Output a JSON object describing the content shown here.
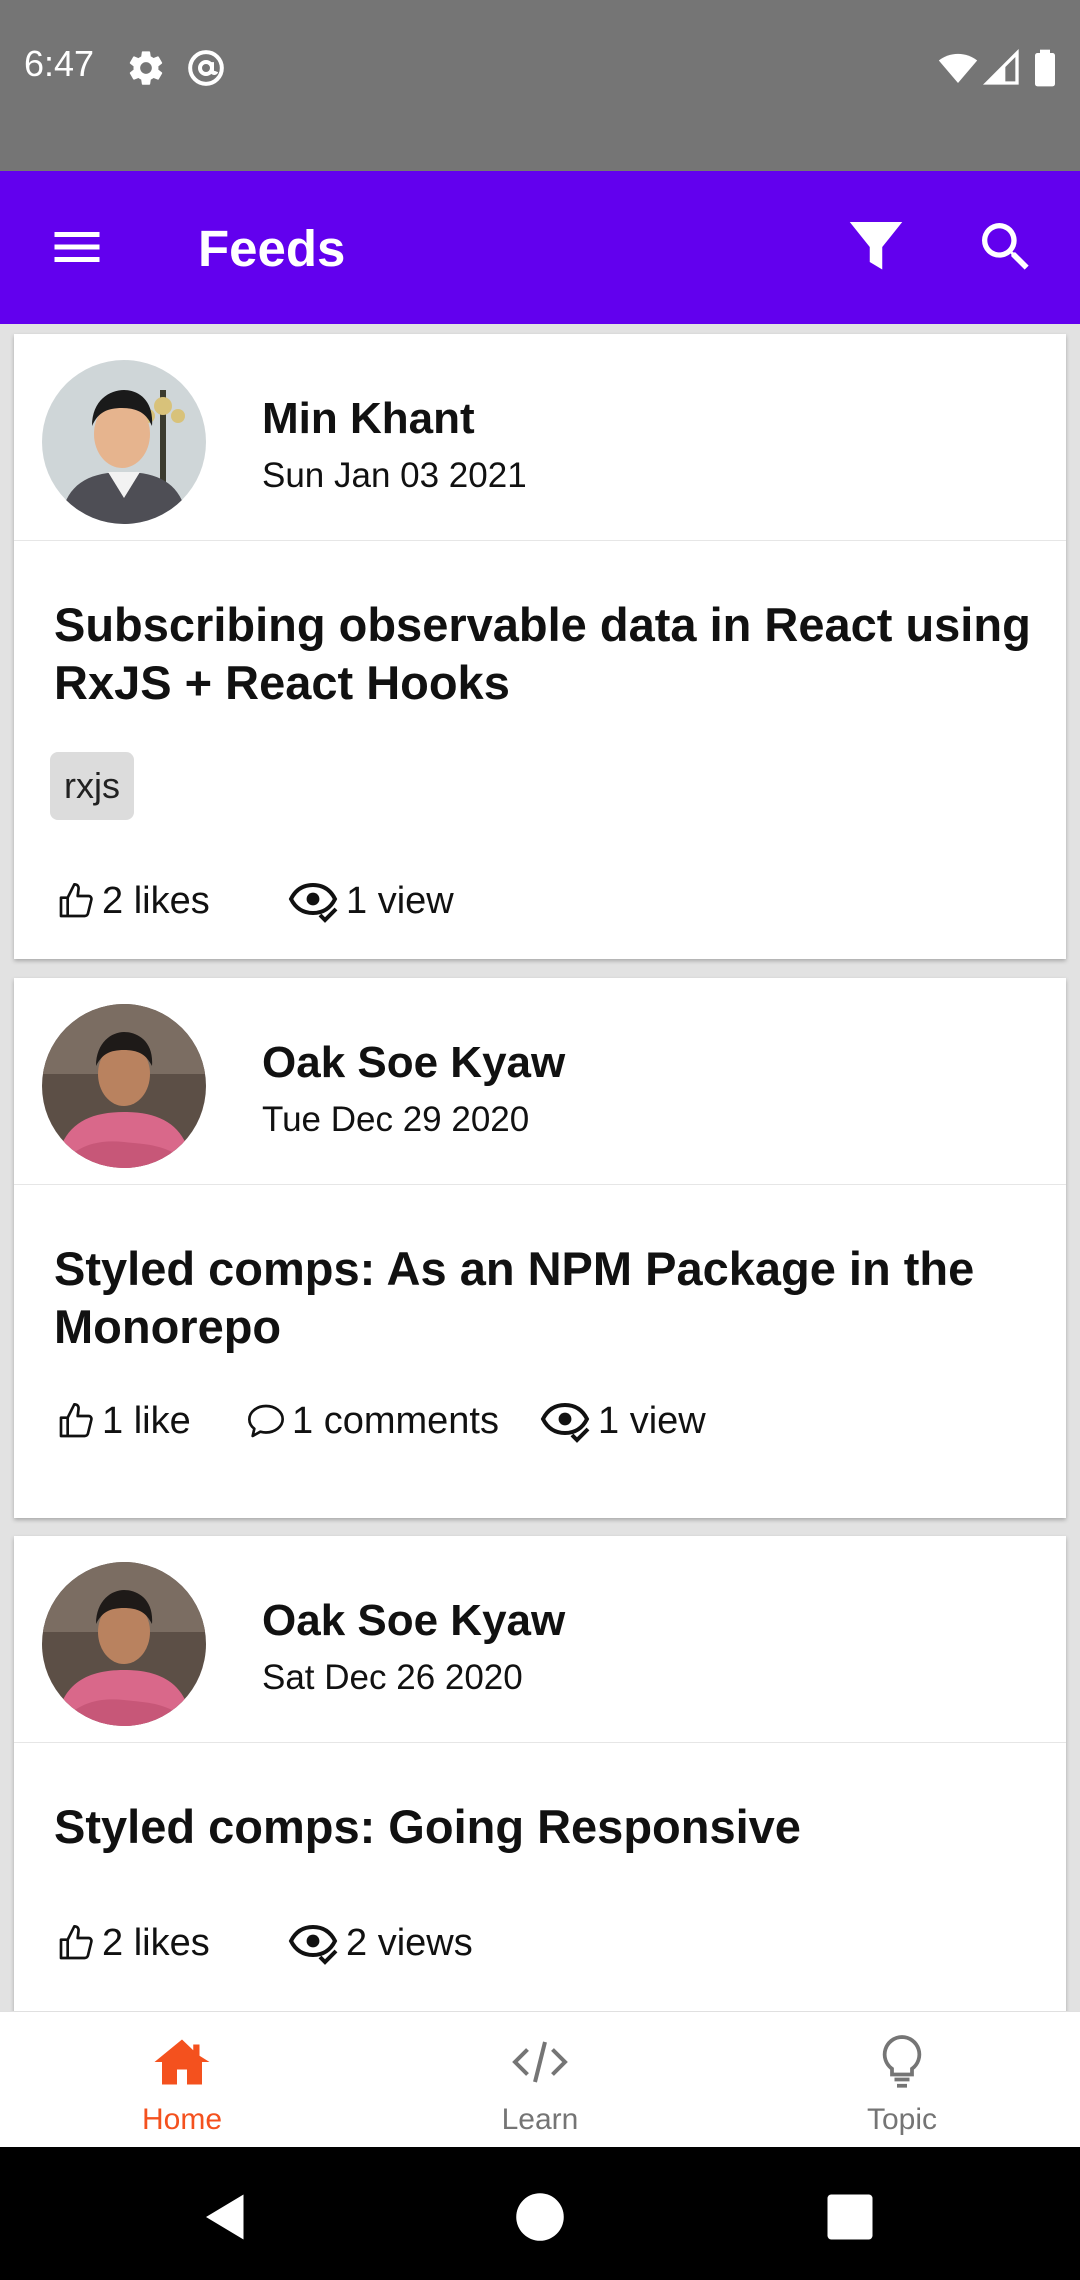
{
  "status_bar": {
    "time": "6:47",
    "icons": [
      "gear-icon",
      "at-sign-icon",
      "wifi-icon",
      "signal-icon",
      "battery-icon"
    ]
  },
  "app_bar": {
    "title": "Feeds",
    "background": "#6200ee",
    "icons": [
      "menu-icon",
      "filter-icon",
      "search-icon"
    ]
  },
  "feed": {
    "posts": [
      {
        "author": "Min Khant",
        "date": "Sun Jan 03 2021",
        "title": "Subscribing observable data in React using RxJS + React Hooks",
        "tags": [
          "rxjs"
        ],
        "likes": "2 likes",
        "comments": "",
        "views": "1 view"
      },
      {
        "author": "Oak Soe Kyaw",
        "date": "Tue Dec 29 2020",
        "title": "Styled comps: As an NPM Package in the Monorepo",
        "tags": [],
        "likes": "1 like",
        "comments": "1 comments",
        "views": "1 view"
      },
      {
        "author": "Oak Soe Kyaw",
        "date": "Sat Dec 26 2020",
        "title": "Styled comps: Going Responsive",
        "tags": [],
        "likes": "2 likes",
        "comments": "",
        "views": "2 views"
      }
    ]
  },
  "bottom_nav": {
    "items": [
      {
        "label": "Home",
        "icon": "home-icon",
        "active": true
      },
      {
        "label": "Learn",
        "icon": "code-icon",
        "active": false
      },
      {
        "label": "Topic",
        "icon": "lightbulb-icon",
        "active": false
      }
    ],
    "active_color": "#f4511e",
    "inactive_color": "#757575"
  },
  "system_nav": {
    "icons": [
      "back-icon",
      "home-circle-icon",
      "recents-icon"
    ]
  }
}
